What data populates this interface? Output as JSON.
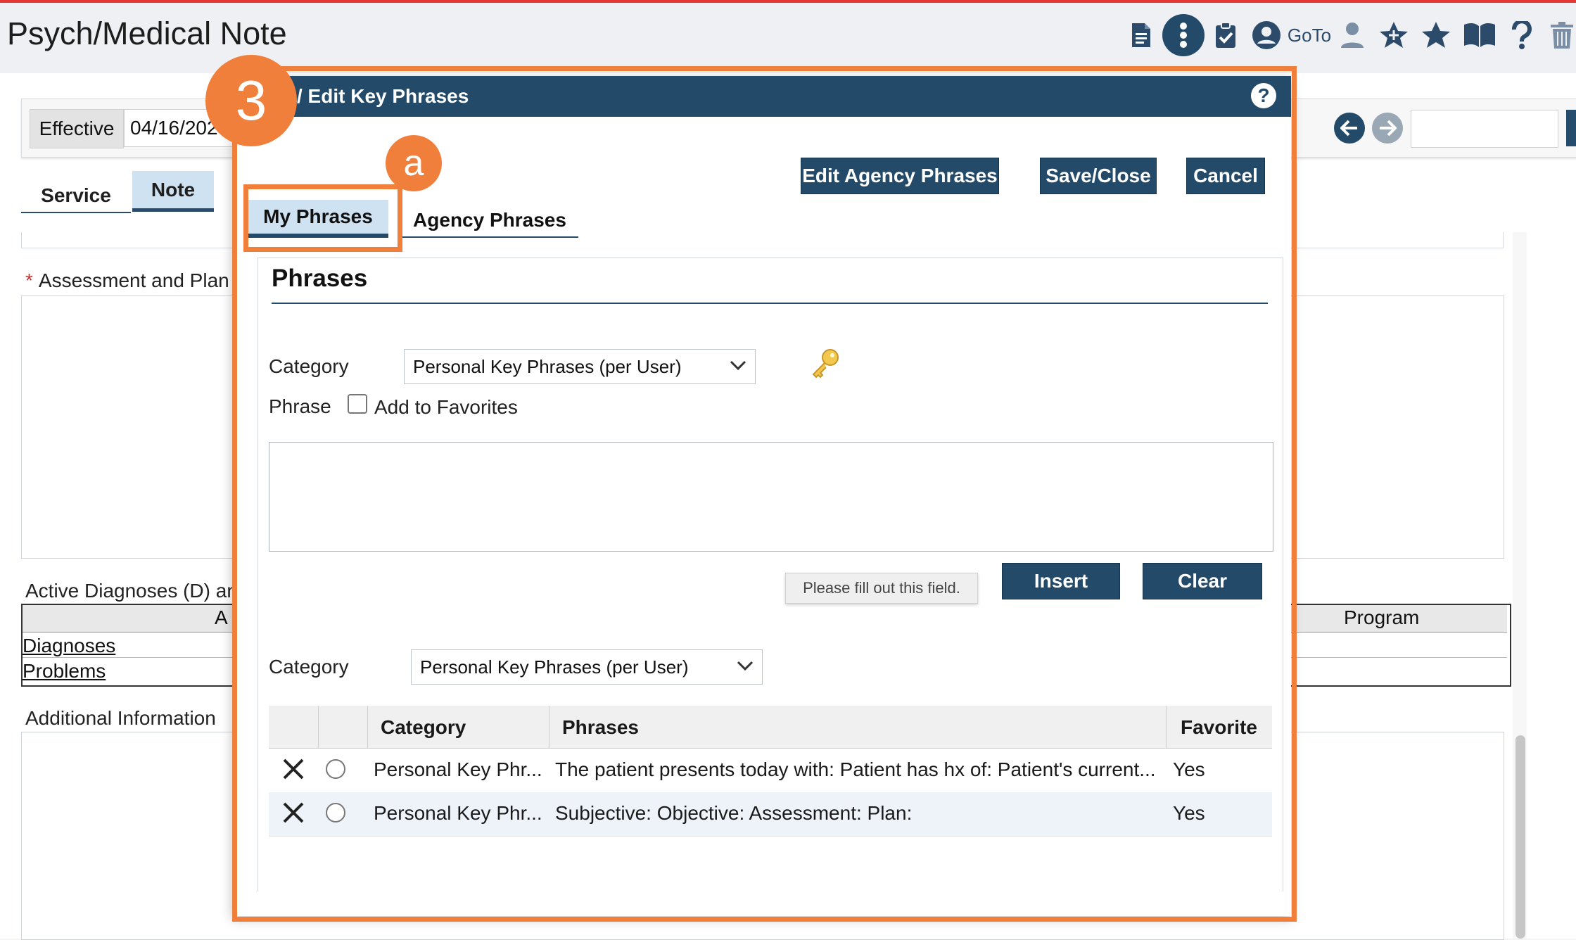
{
  "header": {
    "title": "Psych/Medical Note",
    "goto_label": "GoTo",
    "icons": [
      "document-icon",
      "more-vert-icon",
      "clipboard-check-icon",
      "account-circle-icon",
      "person-icon",
      "star-plus-icon",
      "star-icon",
      "book-icon",
      "help-icon",
      "trash-icon"
    ]
  },
  "background": {
    "effective_label": "Effective",
    "effective_date": "04/16/202",
    "tabs": [
      {
        "label": "Service"
      },
      {
        "label": "Note",
        "active": true
      }
    ],
    "assessment_label": "Assessment and Plan",
    "diagnoses_label": "Active Diagnoses (D) an",
    "diagnoses_table": {
      "col_a": "A",
      "program": "Program",
      "links": [
        "Diagnoses",
        "Problems"
      ]
    },
    "additional_label": "Additional Information"
  },
  "dialog": {
    "title": "/ Edit Key Phrases",
    "help": "?",
    "buttons": {
      "edit_agency": "Edit Agency Phrases",
      "save_close": "Save/Close",
      "cancel": "Cancel",
      "insert": "Insert",
      "clear": "Clear"
    },
    "tabs": [
      {
        "label": "My Phrases",
        "active": true
      },
      {
        "label": "Agency Phrases"
      }
    ],
    "section_title": "Phrases",
    "category_label": "Category",
    "category_value": "Personal Key Phrases (per User)",
    "phrase_label": "Phrase",
    "favorites_label": "Add to Favorites",
    "favorites_checked": false,
    "phrase_value": "",
    "tooltip": "Please fill out this field.",
    "filter_category_label": "Category",
    "filter_category_value": "Personal Key Phrases (per User)",
    "table": {
      "headers": [
        "Category",
        "Phrases",
        "Favorite"
      ],
      "rows": [
        {
          "category": "Personal Key Phr...",
          "phrase": "The patient presents today with: Patient has hx of: Patient's current...",
          "favorite": "Yes"
        },
        {
          "category": "Personal Key Phr...",
          "phrase": "Subjective: Objective: Assessment: Plan:",
          "favorite": "Yes"
        }
      ]
    }
  },
  "annotations": {
    "step": "3",
    "sub": "a",
    "color": "#f07f3c"
  },
  "colors": {
    "primary": "#244a69",
    "tab_active_bg": "#cfe2f2",
    "topline": "#e53935"
  }
}
